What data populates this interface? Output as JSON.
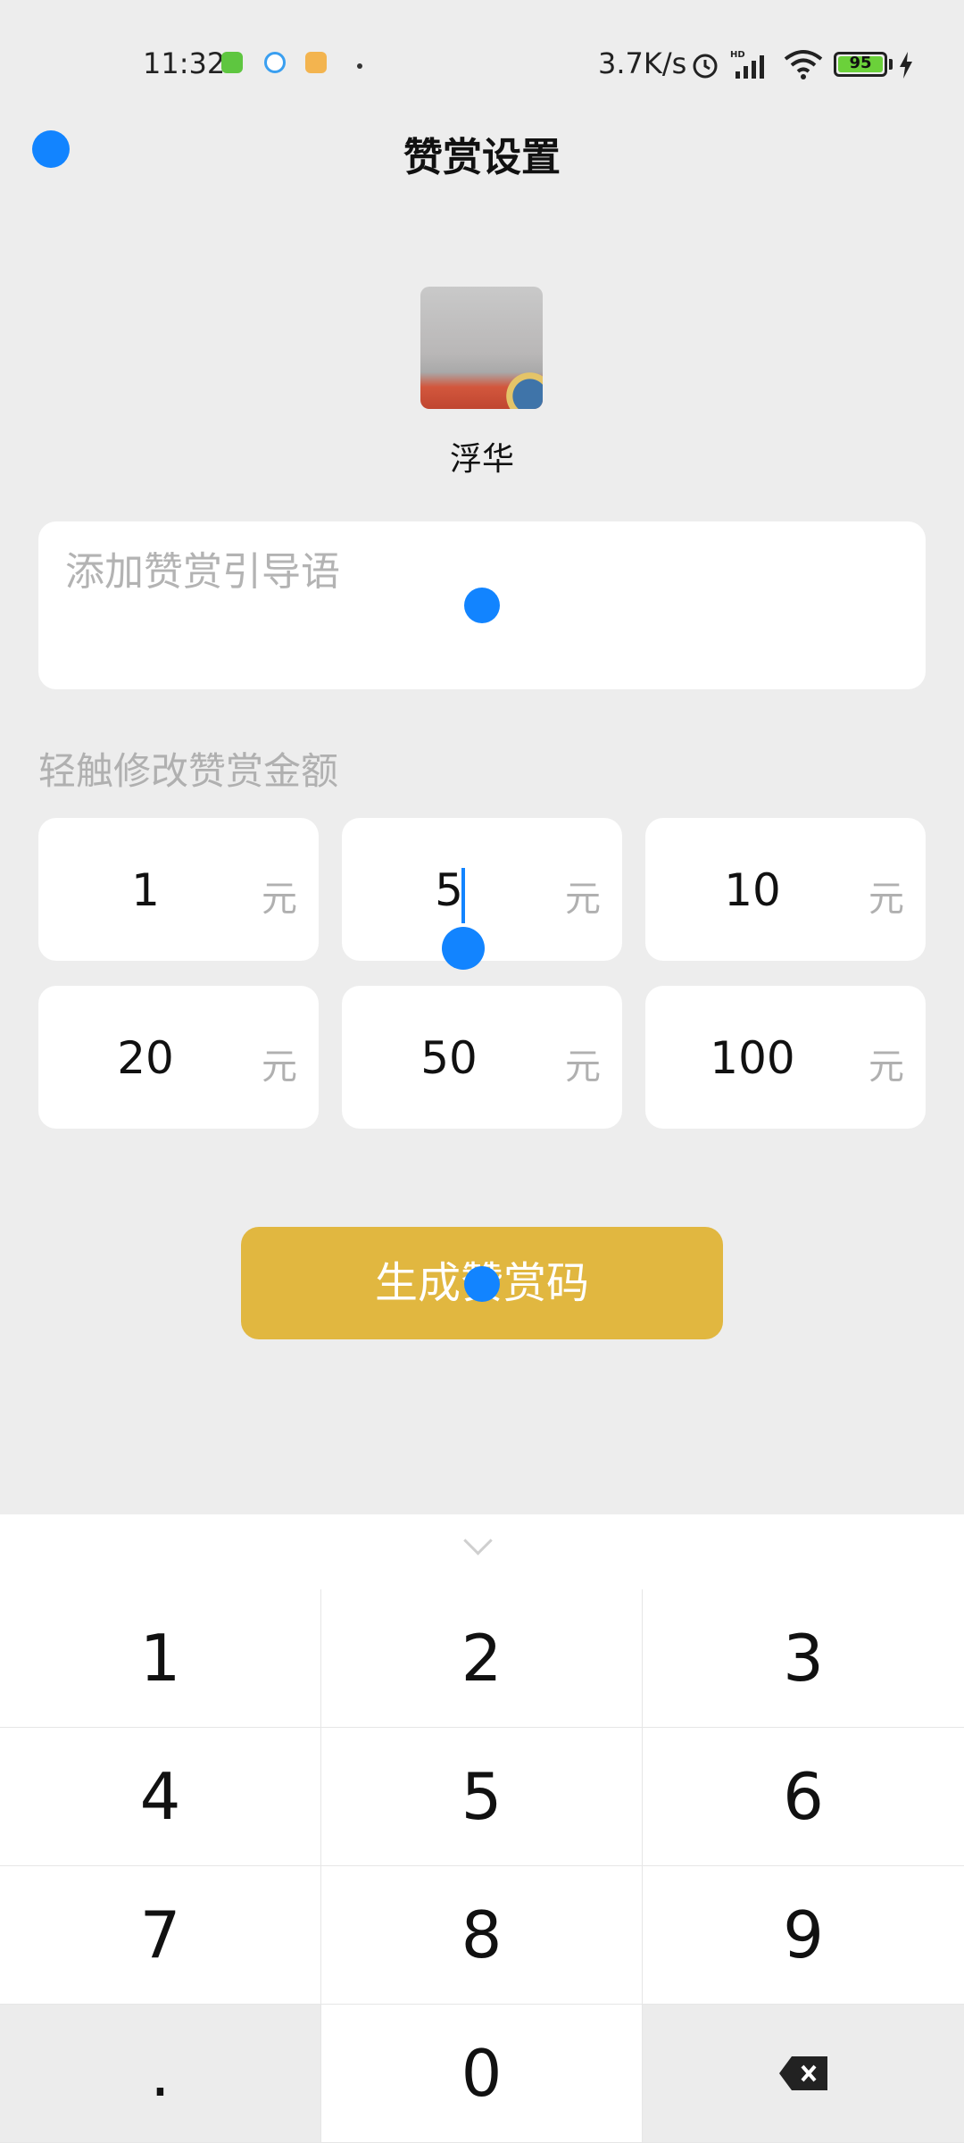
{
  "status_bar": {
    "time": "11:32",
    "network_speed": "3.7K/s",
    "battery": "95",
    "icons": [
      "app-notification-icon",
      "browser-icon",
      "app-icon",
      "alarm-icon",
      "hd-signal-icon",
      "wifi-icon",
      "battery-icon",
      "charging-icon"
    ]
  },
  "nav": {
    "title": "赞赏设置"
  },
  "profile": {
    "name": "浮华"
  },
  "guide": {
    "placeholder": "添加赞赏引导语",
    "value": ""
  },
  "amounts_label": "轻触修改赞赏金额",
  "amounts": [
    {
      "value": "1",
      "unit": "元"
    },
    {
      "value": "5",
      "unit": "元"
    },
    {
      "value": "10",
      "unit": "元"
    },
    {
      "value": "20",
      "unit": "元"
    },
    {
      "value": "50",
      "unit": "元"
    },
    {
      "value": "100",
      "unit": "元"
    }
  ],
  "generate_button": "生成赞赏码",
  "keypad": {
    "keys": [
      "1",
      "2",
      "3",
      "4",
      "5",
      "6",
      "7",
      "8",
      "9",
      ".",
      "0"
    ],
    "delete_icon": "backspace-icon",
    "collapse_icon": "chevron-down-icon"
  },
  "colors": {
    "accent": "#1284ff",
    "button": "#e1b740",
    "background": "#ededed"
  }
}
